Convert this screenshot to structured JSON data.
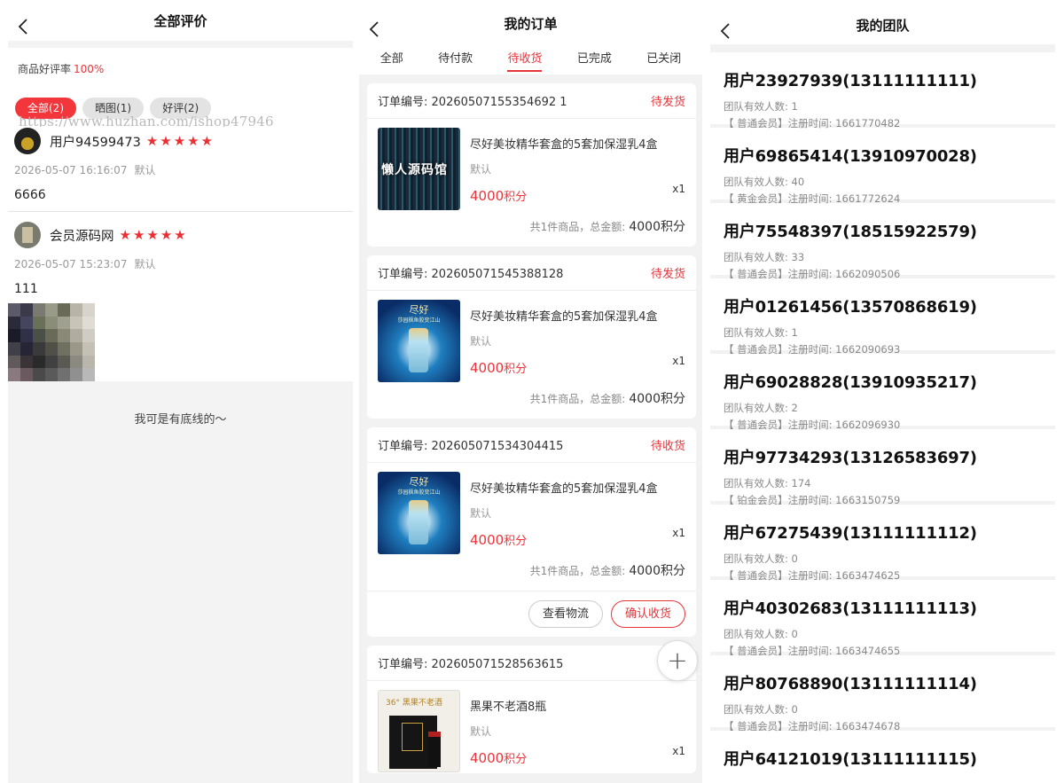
{
  "reviews_page": {
    "title": "全部评价",
    "rate_label": "商品好评率",
    "rate_value": "100%",
    "tags": [
      "全部(2)",
      "晒图(1)",
      "好评(2)"
    ],
    "watermark": "https://www.huzhan.com/ishop47946",
    "reviews": [
      {
        "user": "用户94599473",
        "stars": "★★★★★",
        "time": "2026-05-07 16:16:07",
        "spec": "默认",
        "content": "6666"
      },
      {
        "user": "会员源码网",
        "stars": "★★★★★",
        "time": "2026-05-07 15:23:07",
        "spec": "默认",
        "content": "111"
      }
    ],
    "footer": "我可是有底线的～"
  },
  "orders_page": {
    "title": "我的订单",
    "tabs": [
      "全部",
      "待付款",
      "待收货",
      "已完成",
      "已关闭"
    ],
    "active_tab": 2,
    "orders": [
      {
        "no_label": "订单编号:",
        "no": "20260507155354692 1",
        "status": "待发货",
        "product": "尽好美妆精华套盒的5套加保湿乳4盒",
        "thumb_text": "懒人源码馆",
        "spec": "默认",
        "price": "4000",
        "unit": "积分",
        "qty": "x1",
        "summary": "共1件商品，总金额:",
        "total": "4000积分"
      },
      {
        "no_label": "订单编号:",
        "no": "202605071545388128",
        "status": "待发货",
        "product": "尽好美妆精华套盒的5套加保湿乳4盒",
        "thumb_brand": "尽好",
        "thumb_sub": "莎园枫鱼胶变江山",
        "spec": "默认",
        "price": "4000",
        "unit": "积分",
        "qty": "x1",
        "summary": "共1件商品，总金额:",
        "total": "4000积分"
      },
      {
        "no_label": "订单编号:",
        "no": "202605071534304415",
        "status": "待收货",
        "product": "尽好美妆精华套盒的5套加保湿乳4盒",
        "thumb_brand": "尽好",
        "thumb_sub": "莎园枫鱼胶变江山",
        "spec": "默认",
        "price": "4000",
        "unit": "积分",
        "qty": "x1",
        "summary": "共1件商品，总金额:",
        "total": "4000积分",
        "btn_logistics": "查看物流",
        "btn_confirm": "确认收货"
      },
      {
        "no_label": "订单编号:",
        "no": "202605071528563615",
        "status": "待",
        "product": "黑果不老酒8瓶",
        "thumb_text": "36° 黑果不老酒",
        "spec": "默认",
        "price": "4000",
        "unit": "积分",
        "qty": "x1"
      }
    ],
    "fab": "+"
  },
  "team_page": {
    "title": "我的团队",
    "members": [
      {
        "name": "用户23927939(13111111111)",
        "count": "团队有效人数: 1",
        "level": "【 普通会员】注册时间: 1661770482"
      },
      {
        "name": "用户69865414(13910970028)",
        "count": "团队有效人数: 40",
        "level": "【 黄金会员】注册时间: 1661772624"
      },
      {
        "name": "用户75548397(18515922579)",
        "count": "团队有效人数: 33",
        "level": "【 普通会员】注册时间: 1662090506"
      },
      {
        "name": "用户01261456(13570868619)",
        "count": "团队有效人数: 1",
        "level": "【 普通会员】注册时间: 1662090693"
      },
      {
        "name": "用户69028828(13910935217)",
        "count": "团队有效人数: 2",
        "level": "【 普通会员】注册时间: 1662096930"
      },
      {
        "name": "用户97734293(13126583697)",
        "count": "团队有效人数: 174",
        "level": "【 铂金会员】注册时间: 1663150759"
      },
      {
        "name": "用户67275439(13111111112)",
        "count": "团队有效人数: 0",
        "level": "【 普通会员】注册时间: 1663474625"
      },
      {
        "name": "用户40302683(13111111113)",
        "count": "团队有效人数: 0",
        "level": "【 普通会员】注册时间: 1663474655"
      },
      {
        "name": "用户80768890(13111111114)",
        "count": "团队有效人数: 0",
        "level": "【 普通会员】注册时间: 1663474678"
      },
      {
        "name": "用户64121019(13111111115)",
        "count": "",
        "level": ""
      }
    ]
  }
}
